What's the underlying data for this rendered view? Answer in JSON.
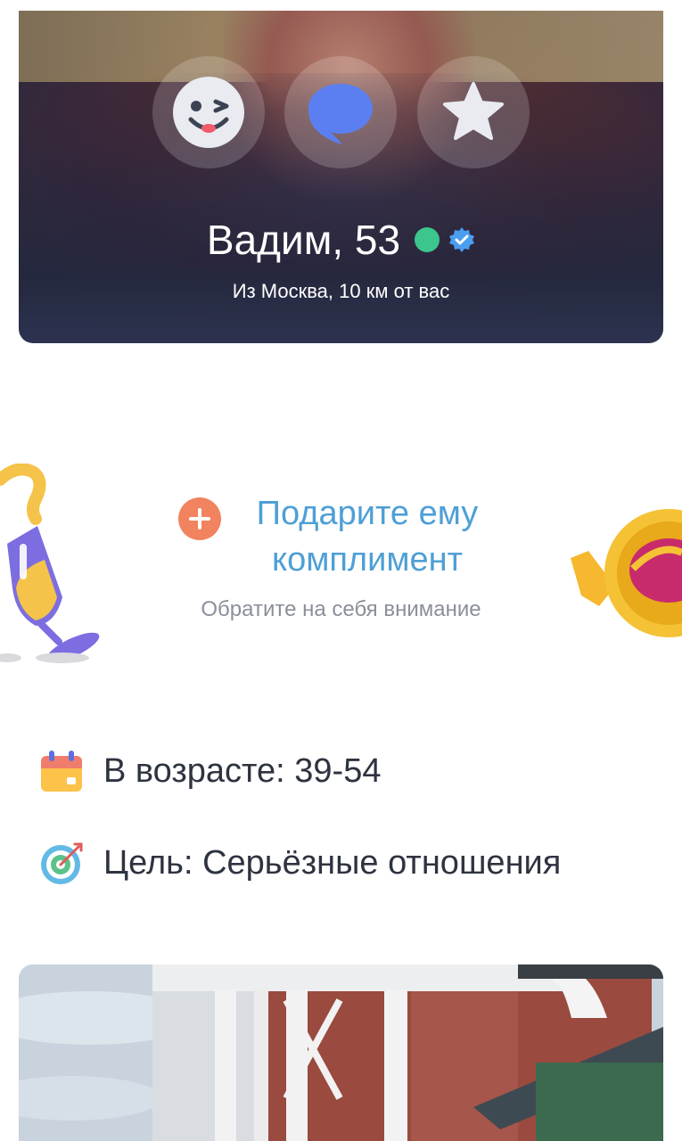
{
  "profile": {
    "name_age": "Вадим, 53",
    "location": "Из Москва, 10 км от вас",
    "online_color": "#3cc58d",
    "verified_color": "#4a9ef0",
    "actions": [
      {
        "icon": "wink-emoji-icon"
      },
      {
        "icon": "message-bubble-icon"
      },
      {
        "icon": "star-icon"
      }
    ]
  },
  "compliment": {
    "title": "Подарите ему комплимент",
    "subtitle": "Обратите на себя внимание",
    "accent_color": "#4e9fd6",
    "plus_color": "#f2835f"
  },
  "info": {
    "age": "В возрасте: 39-54",
    "goal": "Цель: Серьёзные отношения"
  }
}
